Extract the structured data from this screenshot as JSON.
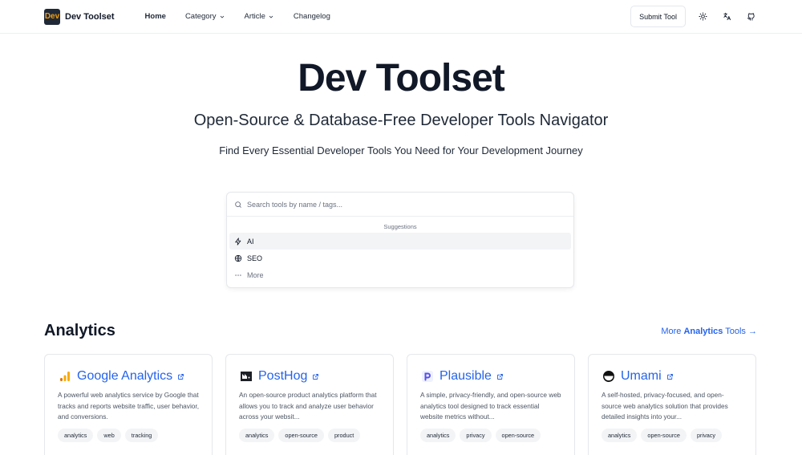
{
  "brand": {
    "logo_text": "Dev",
    "name": "Dev Toolset"
  },
  "nav": [
    {
      "label": "Home",
      "dropdown": false,
      "active": true
    },
    {
      "label": "Category",
      "dropdown": true,
      "active": false
    },
    {
      "label": "Article",
      "dropdown": true,
      "active": false
    },
    {
      "label": "Changelog",
      "dropdown": false,
      "active": false
    }
  ],
  "header_actions": {
    "submit_label": "Submit Tool"
  },
  "hero": {
    "title": "Dev Toolset",
    "subtitle": "Open-Source & Database-Free Developer Tools Navigator",
    "tagline": "Find Every Essential Developer Tools You Need for Your Development Journey"
  },
  "search": {
    "placeholder": "Search tools by name / tags...",
    "value": "",
    "suggestions_label": "Suggestions",
    "suggestions": [
      {
        "label": "AI",
        "icon": "zap-icon"
      },
      {
        "label": "SEO",
        "icon": "globe-icon"
      },
      {
        "label": "More",
        "icon": "dots-icon"
      }
    ]
  },
  "section": {
    "title": "Analytics",
    "more_prefix": "More",
    "more_bold": "Analytics",
    "more_suffix": "Tools →"
  },
  "cards": [
    {
      "name": "Google Analytics",
      "icon": "google-analytics-logo",
      "description": "A powerful web analytics service by Google that tracks and reports website traffic, user behavior, and conversions.",
      "tags": [
        "analytics",
        "web",
        "tracking"
      ]
    },
    {
      "name": "PostHog",
      "icon": "posthog-logo",
      "description": "An open-source product analytics platform that allows you to track and analyze user behavior across your websit...",
      "tags": [
        "analytics",
        "open-source",
        "product"
      ]
    },
    {
      "name": "Plausible",
      "icon": "plausible-logo",
      "description": "A simple, privacy-friendly, and open-source web analytics tool designed to track essential website metrics without...",
      "tags": [
        "analytics",
        "privacy",
        "open-source"
      ]
    },
    {
      "name": "Umami",
      "icon": "umami-logo",
      "description": "A self-hosted, privacy-focused, and open-source web analytics solution that provides detailed insights into your...",
      "tags": [
        "analytics",
        "open-source",
        "privacy"
      ]
    }
  ],
  "colors": {
    "accent": "#2563eb",
    "text": "#111827",
    "muted": "#6b7280",
    "tag_bg": "#f3f4f6"
  }
}
